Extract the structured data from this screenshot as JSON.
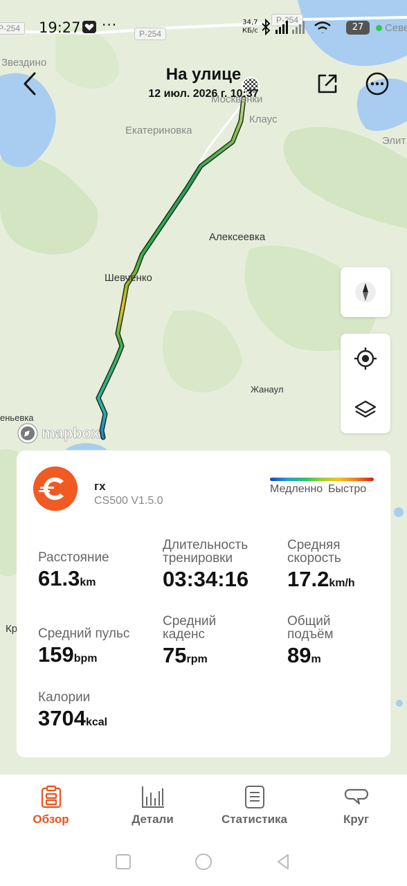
{
  "status_bar": {
    "time": "19:27",
    "net_speed_value": "34,7",
    "net_speed_unit": "КБ/с",
    "battery": "27"
  },
  "header": {
    "title": "На улице",
    "date": "12 июл. 2026 г. 10:37"
  },
  "map": {
    "road_shields": [
      "Р-254",
      "Р-254",
      "Р-254"
    ],
    "labels": {
      "zvezdino": "Звездино",
      "moskovenki": "Москвенки",
      "klaus": "Клаус",
      "ekaterinovka": "Екатериновка",
      "elit": "Элит",
      "alekseevka": "Алексеевка",
      "shevchenko": "Шевченко",
      "zhanaaul": "Жанаул",
      "enevka": "еньевка",
      "kr": "Кр",
      "seve": "Севе"
    },
    "attribution": "mapbox",
    "route_color_scale": [
      "#1f3fc8",
      "#1fa0e0",
      "#25c46a",
      "#9fd12c",
      "#f3c21a",
      "#f07c16",
      "#d91c1c"
    ]
  },
  "device": {
    "name": "гх",
    "model": "CS500  V1.5.0",
    "logo_color": "#f15a22"
  },
  "legend": {
    "slow": "Медленно",
    "fast": "Быстро"
  },
  "stats": {
    "distance": {
      "label": "Расстояние",
      "value": "61.3",
      "unit": "km"
    },
    "duration": {
      "label": "Длительность\nтренировки",
      "value": "03:34:16",
      "unit": ""
    },
    "avg_speed": {
      "label": "Средняя\nскорость",
      "value": "17.2",
      "unit": "km/h"
    },
    "avg_hr": {
      "label": "Средний пульс",
      "value": "159",
      "unit": "bpm"
    },
    "avg_cadence": {
      "label": "Средний\nкаденс",
      "value": "75",
      "unit": "rpm"
    },
    "elevation": {
      "label": "Общий\nподъём",
      "value": "89",
      "unit": "m"
    },
    "calories": {
      "label": "Калории",
      "value": "3704",
      "unit": "kcal"
    }
  },
  "tabs": [
    {
      "label": "Обзор",
      "icon": "overview-icon",
      "active": true
    },
    {
      "label": "Детали",
      "icon": "chart-icon",
      "active": false
    },
    {
      "label": "Статистика",
      "icon": "list-icon",
      "active": false
    },
    {
      "label": "Круг",
      "icon": "lap-icon",
      "active": false
    }
  ],
  "colors": {
    "accent": "#e8531e",
    "water": "#a8cdf0",
    "map_base": "#e6eedb"
  }
}
